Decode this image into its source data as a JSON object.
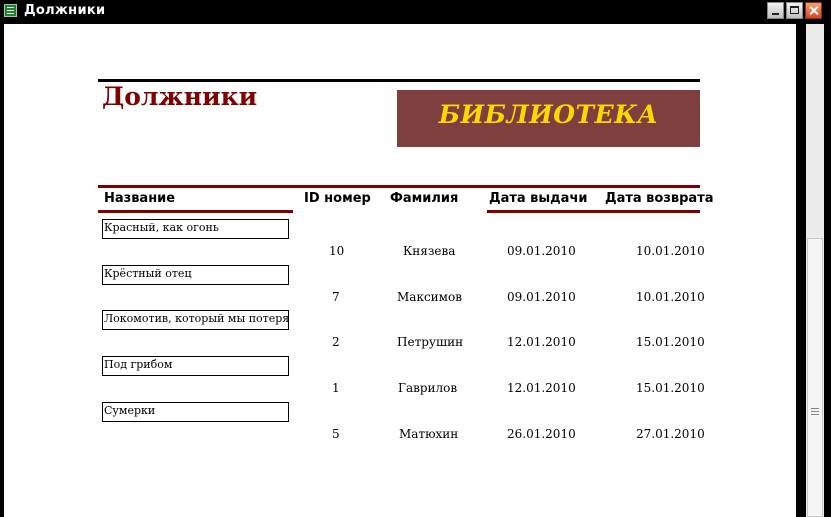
{
  "window": {
    "title": "Должники"
  },
  "report": {
    "title": "Должники",
    "banner": "БИБЛИОТЕКА",
    "columns": {
      "name": "Название",
      "id": "ID номер",
      "surname": "Фамилия",
      "issue_date": "Дата выдачи",
      "return_date": "Дата возврата"
    },
    "rows": [
      {
        "name": "Красный, как огонь",
        "id": "10",
        "surname": "Князева",
        "issue_date": "09.01.2010",
        "return_date": "10.01.2010"
      },
      {
        "name": "Крёстный отец",
        "id": "7",
        "surname": "Максимов",
        "issue_date": "09.01.2010",
        "return_date": "10.01.2010"
      },
      {
        "name": "Локомотив, который мы потеряли",
        "id": "2",
        "surname": "Петрушин",
        "issue_date": "12.01.2010",
        "return_date": "15.01.2010"
      },
      {
        "name": "Под грибом",
        "id": "1",
        "surname": "Гаврилов",
        "issue_date": "12.01.2010",
        "return_date": "15.01.2010"
      },
      {
        "name": "Сумерки",
        "id": "5",
        "surname": "Матюхин",
        "issue_date": "26.01.2010",
        "return_date": "27.01.2010"
      }
    ]
  },
  "colors": {
    "title": "#800000",
    "banner_bg": "#7f3f3f",
    "banner_text": "#ffd700"
  },
  "icons": {
    "app": "report-icon",
    "minimize": "minimize-icon",
    "maximize": "maximize-icon",
    "close": "close-icon"
  }
}
